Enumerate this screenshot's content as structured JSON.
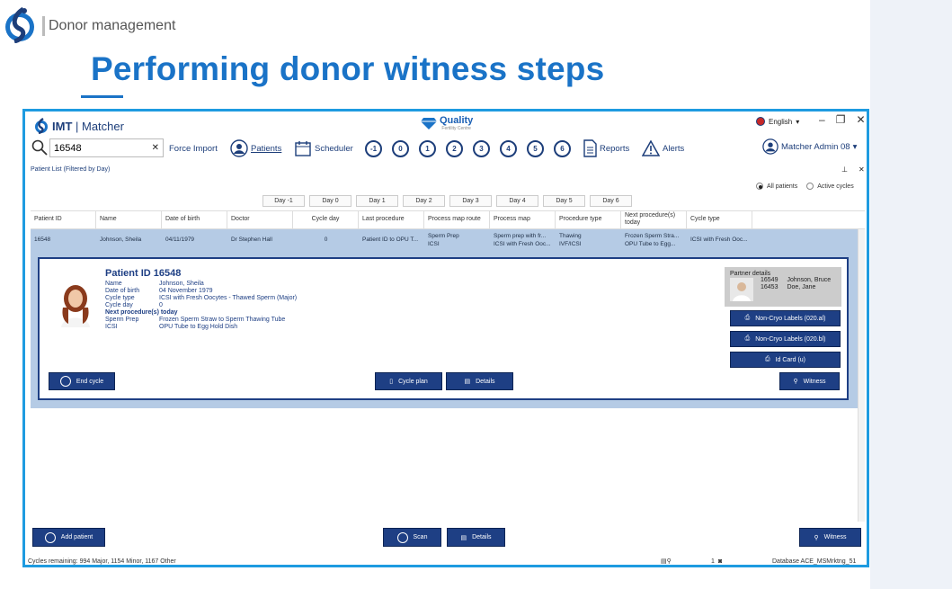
{
  "slide": {
    "section": "Donor management",
    "title": "Performing donor witness steps"
  },
  "app": {
    "brand_bold": "IMT",
    "brand_rest": "Matcher",
    "clinic": "Quality",
    "clinic_sub": "Fertility Centre",
    "language": "English",
    "search_value": "16548",
    "toolbar": {
      "force_import": "Force Import",
      "patients": "Patients",
      "scheduler": "Scheduler",
      "days": [
        "-1",
        "0",
        "1",
        "2",
        "3",
        "4",
        "5",
        "6"
      ],
      "reports": "Reports",
      "alerts": "Alerts"
    },
    "user": "Matcher Admin 08",
    "list_title": "Patient List (Filtered by Day)",
    "day_tabs": [
      "Day -1",
      "Day 0",
      "Day 1",
      "Day 2",
      "Day 3",
      "Day 4",
      "Day 5",
      "Day 6"
    ],
    "filter": {
      "all": "All patients",
      "active": "Active cycles"
    },
    "columns": [
      "Patient ID",
      "Name",
      "Date of birth",
      "Doctor",
      "Cycle day",
      "Last procedure",
      "Process map route",
      "Process map",
      "Procedure type",
      "Next procedure(s) today",
      "Cycle type"
    ],
    "row": {
      "patient_id": "16548",
      "name": "Johnson, Sheila",
      "dob": "04/11/1979",
      "doctor": "Dr Stephen Hall",
      "cycle_day": "0",
      "last_procedure": "Patient ID to OPU T...",
      "route_1": "Sperm Prep",
      "route_2": "ICSI",
      "map_1": "Sperm prep with fr...",
      "map_2": "ICSI with Fresh Ooc...",
      "type_1": "Thawing",
      "type_2": "IVF/ICSI",
      "next_1": "Frozen Sperm Stra...",
      "next_2": "OPU Tube to Egg...",
      "cycle_type": "ICSI with Fresh Ooc..."
    },
    "detail": {
      "title": "Patient ID 16548",
      "fields": [
        {
          "k": "Name",
          "v": "Johnson, Sheila"
        },
        {
          "k": "Date of birth",
          "v": "04 November 1979"
        },
        {
          "k": "Cycle type",
          "v": "ICSI with Fresh Oocytes - Thawed Sperm (Major)"
        },
        {
          "k": "Cycle day",
          "v": "0"
        }
      ],
      "next_heading": "Next procedure(s) today",
      "next": [
        {
          "k": "Sperm Prep",
          "v": "Frozen Sperm Straw to Sperm Thawing Tube"
        },
        {
          "k": "ICSI",
          "v": "OPU Tube to Egg Hold Dish"
        }
      ],
      "partner_heading": "Partner details",
      "partners": [
        {
          "id": "16549",
          "name": "Johnson, Bruce"
        },
        {
          "id": "16453",
          "name": "Doe, Jane"
        }
      ],
      "btn_noncryo_1": "Non-Cryo Labels (020.al)",
      "btn_noncryo_2": "Non-Cryo Labels (020.bl)",
      "btn_idcard": "Id Card (u)",
      "btn_end_cycle": "End cycle",
      "btn_cycle_plan": "Cycle plan",
      "btn_details": "Details",
      "btn_witness": "Witness"
    },
    "footer": {
      "add_patient": "Add patient",
      "scan": "Scan",
      "details": "Details",
      "witness": "Witness"
    },
    "status": {
      "cycles": "Cycles remaining: 994 Major, 1154 Minor, 1167 Other",
      "count": "1",
      "database": "Database  ACE_MSMrktng_51"
    }
  }
}
